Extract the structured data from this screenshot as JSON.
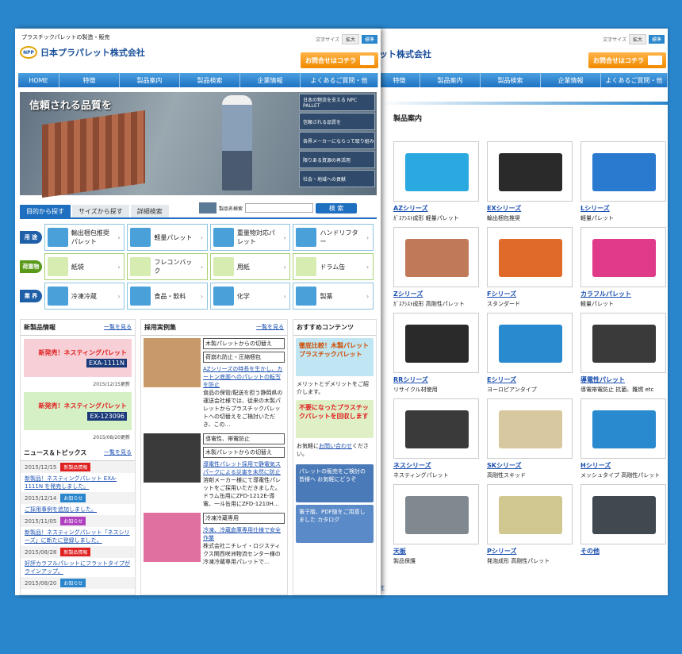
{
  "front": {
    "tagline": "プラスチックパレットの製造・販売",
    "company": "日本プラパレット株式会社",
    "logo_mark": "NPP",
    "font_size_label": "文字サイズ",
    "font_size_large": "拡大",
    "font_size_std": "標準",
    "contact": "お問合せはコチラ",
    "nav": [
      "HOME",
      "特徴",
      "製品案内",
      "製品検索",
      "企業情報",
      "よくあるご質問・他"
    ],
    "hero_title": "信頼される品質を",
    "hero_side": [
      "日本の物流を支える NPC PALLET",
      "信頼される品質を",
      "各界メーカーにならって取り組み",
      "限りある資源の再活用",
      "社会・地域への貢献"
    ],
    "tabs": [
      "目的から探す",
      "サイズから探す",
      "詳細検索"
    ],
    "search_label": "製品名検索",
    "search_button": "検 索",
    "grid": [
      {
        "label": "用 途",
        "color": "#1f5fa8",
        "cells": [
          "輸出梱包推奨パレット",
          "軽量パレット",
          "重量物対応パレット",
          "ハンドリフター"
        ]
      },
      {
        "label": "荷重物",
        "color": "#5a9a1a",
        "cells": [
          "紙袋",
          "フレコンバック",
          "用紙",
          "ドラム缶"
        ]
      },
      {
        "label": "業 界",
        "color": "#1f5fa8",
        "cells": [
          "冷凍冷蔵",
          "食品・飲料",
          "化学",
          "製薬"
        ]
      }
    ],
    "news_title": "新製品情報",
    "more": "一覧を見る",
    "new_items": [
      {
        "title": "新発売！ネスティングパレット",
        "code": "EXA-1111N",
        "updated": "2015/12/15更新",
        "color": "#f6d0d6"
      },
      {
        "title": "新発売！ネスティングパレット",
        "code": "EX-123096",
        "updated": "2015/08/20更新",
        "color": "#d6f0c6"
      }
    ],
    "topics_title": "ニュース＆トピックス",
    "topics": [
      {
        "date": "2015/12/15",
        "badge": "新製品情報",
        "badge_color": "#e02020",
        "text": "新製品！ネスティングパレット EXA-1111N を発売しました。"
      },
      {
        "date": "2015/12/14",
        "badge": "お知らせ",
        "badge_color": "#2a86cc",
        "text": "ご採用事例を追加しました。"
      },
      {
        "date": "2015/11/05",
        "badge": "お知らせ",
        "badge_color": "#b040c0",
        "text": "新製品！ネスティングパレット「ネスシリーズ」に新たに登録しました。"
      },
      {
        "date": "2015/08/28",
        "badge": "新製品情報",
        "badge_color": "#e02020",
        "text": "好評カラフルパレットにフラットタイプがラインアップ。"
      },
      {
        "date": "2015/08/20",
        "badge": "お知らせ",
        "badge_color": "#2a86cc",
        "text": ""
      }
    ],
    "cases_title": "採用実例集",
    "cases": [
      {
        "head": "木製パレットからの切替え",
        "tag": "荷崩れ防止・圧縮梱包",
        "link": "AZシリーズの特長を生かし、カートン底面へのパレットの転写を防止",
        "text": "食品の保管/配送を担う静岡県の運送会社様では、従来の木製パレットからプラスチックパレットへの切替えをご検討いただき、この…",
        "color": "#c89a6a"
      },
      {
        "head": "導電性、帯電防止",
        "tag": "木製パレットからの切替え",
        "link": "導電性パレット採用で静電気スパークによる災害を未然に防止",
        "text": "溶剤メーカー様にて導電性パレットをご採用いただきました。ドラム缶用にZFD-1212E-導電、一斗缶用にZFD-1210H…",
        "color": "#3a3a3a"
      },
      {
        "head": "冷凍冷蔵専用",
        "tag": "",
        "link": "冷凍、冷蔵倉庫専用仕様で安全作業",
        "text": "株式会社ニチレイ・ロジスティクス関西咲洲物流センター様の冷凍冷蔵専用パレットで…",
        "color": "#e070a0"
      }
    ],
    "reco_title": "おすすめコンテンツ",
    "reco": [
      {
        "text": "徹底比較！木製パレット プラスチックパレット",
        "color": "#bfe6f2"
      },
      {
        "text": "不要になったプラスチックパレットを回収します",
        "color": "#dff0c6"
      }
    ],
    "reco_note1": "メリットとデメリットをご紹介します。",
    "reco_note2_a": "お気軽に",
    "reco_note2_link": "お問い合わせ",
    "reco_note2_b": "ください。",
    "banners": [
      {
        "text": "パレットの販売をご検討の皆様へ お気軽にどうぞ",
        "color": "#4a7ab8"
      },
      {
        "text": "電子版、PDF版をご用意しました カタログ",
        "color": "#5a8ac8"
      }
    ]
  },
  "back": {
    "company": "ット株式会社",
    "contact": "お問合せはコチラ",
    "nav": [
      "特徴",
      "製品案内",
      "製品検索",
      "企業情報",
      "よくあるご質問・他"
    ],
    "heading": "製品案内",
    "footer": "社",
    "products": [
      {
        "name": "AZシリーズ",
        "desc": "ｶﾞｽｱｼｽﾄ成形 軽量パレット",
        "color": "#2aa8e0"
      },
      {
        "name": "EXシリーズ",
        "desc": "輸出梱包推奨",
        "color": "#2a2a2a"
      },
      {
        "name": "Lシリーズ",
        "desc": "軽量パレット",
        "color": "#2a7ad0"
      },
      {
        "name": "Zシリーズ",
        "desc": "ｶﾞｽｱｼｽﾄ成形 高剛性パレット",
        "color": "#c07a5a"
      },
      {
        "name": "Fシリーズ",
        "desc": "スタンダード",
        "color": "#e06a2a"
      },
      {
        "name": "カラフルパレット",
        "desc": "軽量パレット",
        "color": "#e03a8a"
      },
      {
        "name": "RRシリーズ",
        "desc": "リサイクル材使用",
        "color": "#2a2a2a"
      },
      {
        "name": "Eシリーズ",
        "desc": "ヨーロピアンタイプ",
        "color": "#2a8ad0"
      },
      {
        "name": "導電性パレット",
        "desc": "導電帯電防止 抗菌、難燃 etc",
        "color": "#3a3a3a"
      },
      {
        "name": "ネスシリーズ",
        "desc": "ネスティングパレット",
        "color": "#3a3a3a"
      },
      {
        "name": "SKシリーズ",
        "desc": "高剛性スキッド",
        "color": "#d8c8a0"
      },
      {
        "name": "Hシリーズ",
        "desc": "メッシュタイプ 高剛性パレット",
        "color": "#2a8ad0"
      },
      {
        "name": "天板",
        "desc": "製品保護",
        "color": "#808890"
      },
      {
        "name": "Pシリーズ",
        "desc": "発泡成形 高剛性パレット",
        "color": "#d0c890"
      },
      {
        "name": "その他",
        "desc": "",
        "color": "#404850"
      }
    ]
  }
}
